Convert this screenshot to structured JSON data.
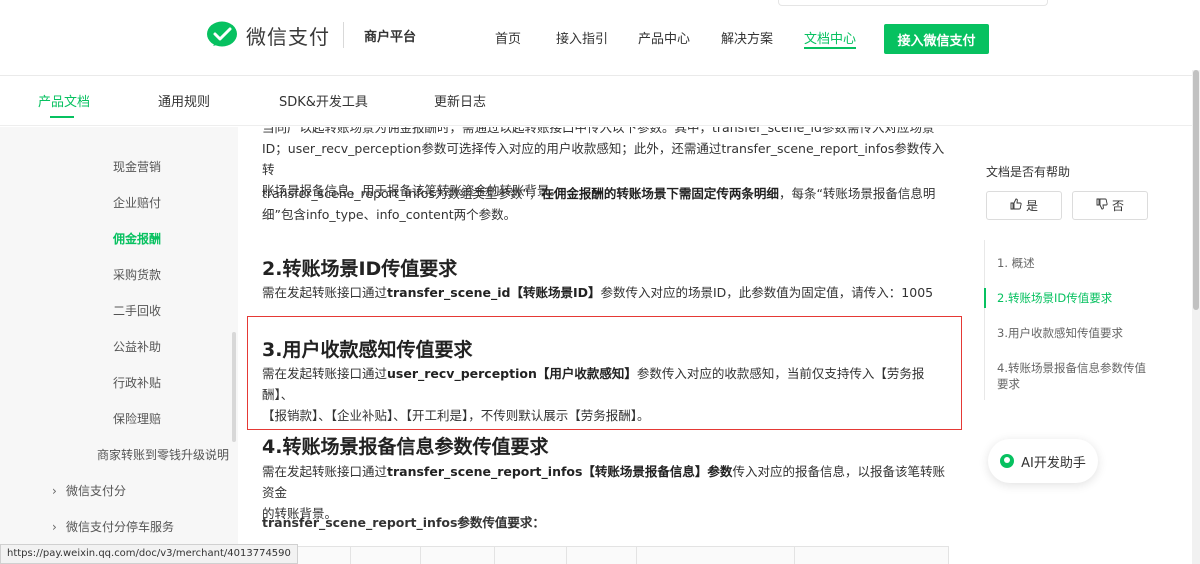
{
  "header": {
    "brand": "微信支付",
    "merchant": "商户平台",
    "nav": [
      "首页",
      "接入指引",
      "产品中心",
      "解决方案",
      "文档中心"
    ],
    "cta": "接入微信支付",
    "accent": "#07c160"
  },
  "subnav": [
    "产品文档",
    "通用规则",
    "SDK&开发工具",
    "更新日志"
  ],
  "sidebar": {
    "items": [
      "现金营销",
      "企业赔付",
      "佣金报酬",
      "采购货款",
      "二手回收",
      "公益补助",
      "行政补贴",
      "保险理赔",
      "商家转账到零钱升级说明"
    ],
    "active": "佣金报酬",
    "groups": [
      "微信支付分",
      "微信支付分停车服务"
    ]
  },
  "content": {
    "p0_line1": "当同产以起转账场景为佣金报酬时，需通过以起转账接口中传入以下参数。其中，transfer_scene_id参数需传入对应场景",
    "p0_line2": "ID；user_recv_perception参数可选择传入对应的用户收款感知；此外，还需通过transfer_scene_report_infos参数传入转",
    "p0_line3": "账场景报备信息，用于报备该笔转账资金的转账背景。",
    "p1_a": "transfer_scene_report_infos为数组类型参数”，",
    "p1_b": "在佣金报酬的转账场景下需固定传两条明细",
    "p1_c": "，每条“转账场景报备信息明",
    "p1_line2": "细”包含info_type、info_content两个参数。",
    "h2": "2.转账场景ID传值要求",
    "p2_a": "需在发起转账接口通过",
    "p2_b": "transfer_scene_id【转账场景ID】",
    "p2_c": "参数传入对应的场景ID，此参数值为固定值，请传入：1005",
    "h3": "3.用户收款感知传值要求",
    "p3_a": "需在发起转账接口通过",
    "p3_b": "user_recv_perception【用户收款感知】",
    "p3_c": "参数传入对应的收款感知，当前仅支持传入【劳务报酬】、",
    "p3_line2": "【报销款】、【企业补贴】、【开工利是】，不传则默认展示【劳务报酬】。",
    "h4": "4.转账场景报备信息参数传值要求",
    "p4_a": "需在发起转账接口通过",
    "p4_b": "transfer_scene_report_infos【转账场景报备信息】参数",
    "p4_c": "传入对应的报备信息，以报备该笔转账资金",
    "p4_line2": "的转账背景。",
    "p5": "transfer_scene_report_infos参数传值要求："
  },
  "right": {
    "help_title": "文档是否有帮助",
    "yes": "是",
    "no": "否",
    "toc": [
      "1. 概述",
      "2.转账场景ID传值要求",
      "3.用户收款感知传值要求",
      "4.转账场景报备信息参数传值要求"
    ],
    "toc_active": "2.转账场景ID传值要求",
    "ai": "AI开发助手"
  },
  "status_url": "https://pay.weixin.qq.com/doc/v3/merchant/4013774590"
}
